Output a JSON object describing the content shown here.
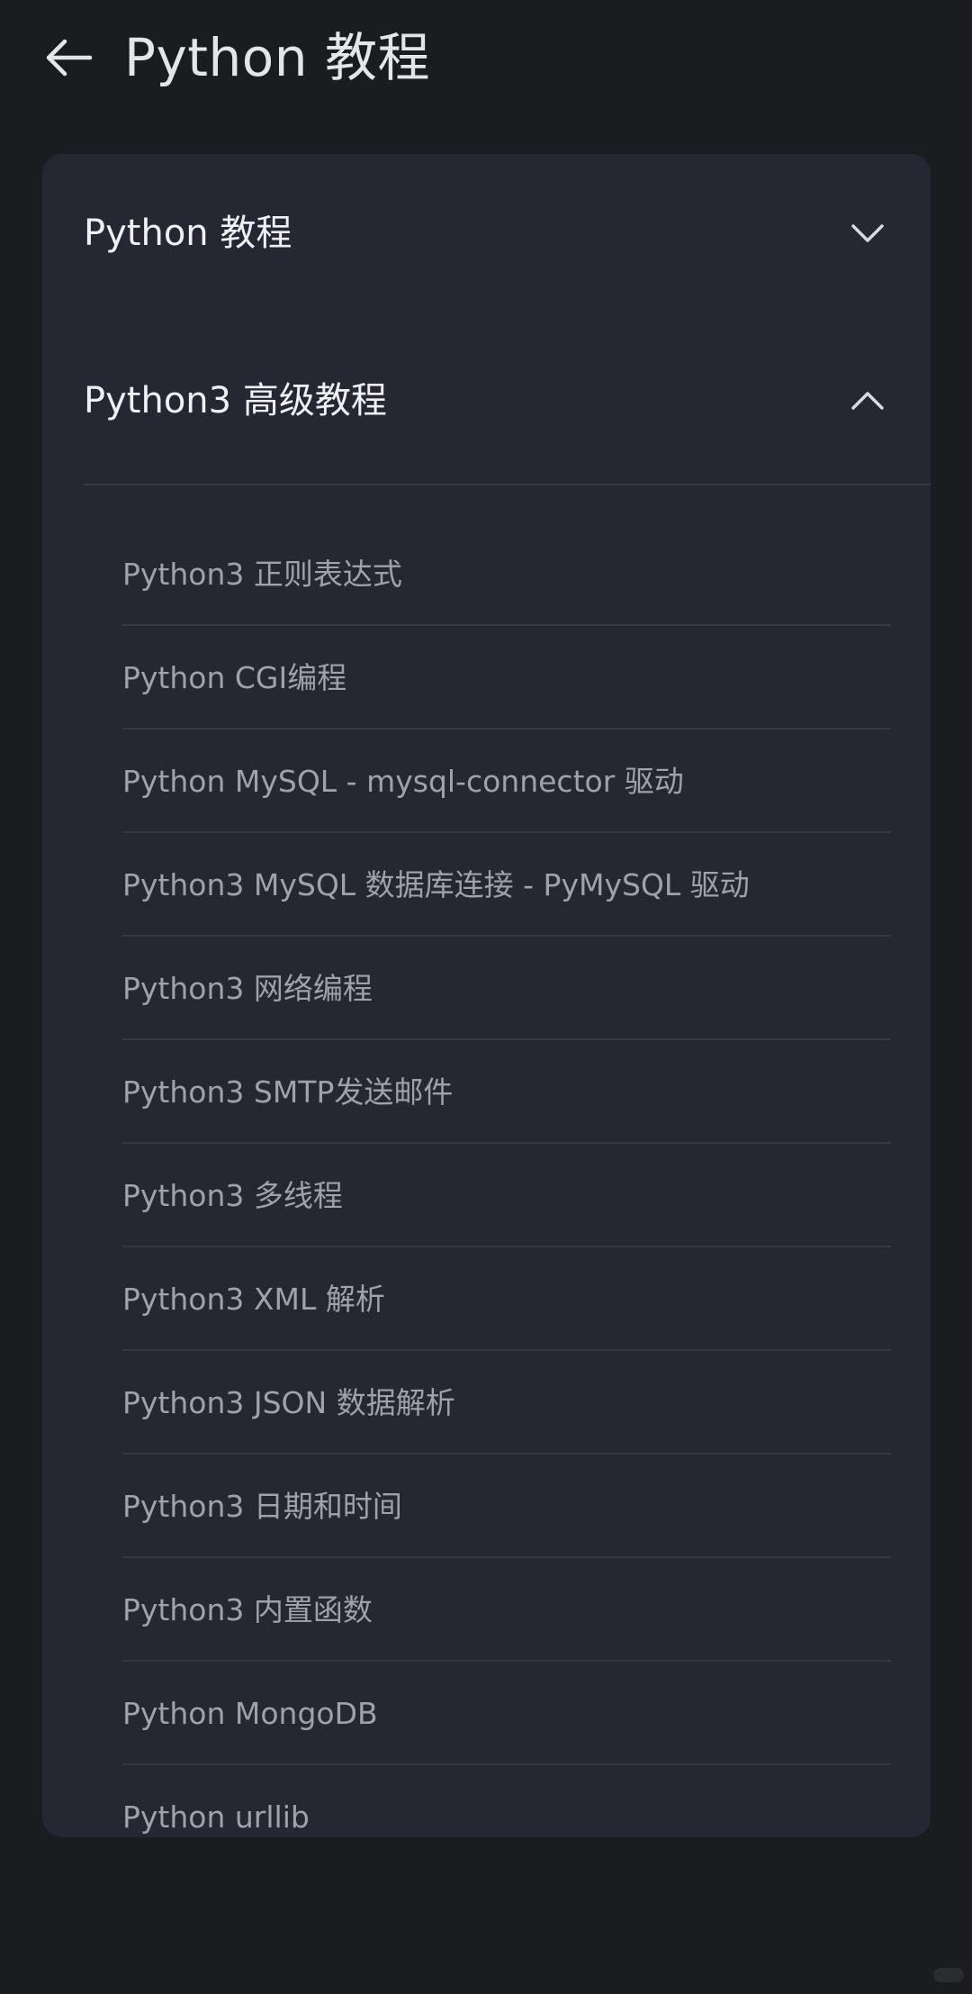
{
  "header": {
    "back_icon": "arrow-left-icon",
    "title": "Python 教程"
  },
  "sections": [
    {
      "label": "Python 教程",
      "expanded": false,
      "icon": "chevron-down-icon"
    },
    {
      "label": "Python3 高级教程",
      "expanded": true,
      "icon": "chevron-up-icon",
      "items": [
        "Python3 正则表达式",
        "Python CGI编程",
        "Python MySQL - mysql-connector 驱动",
        "Python3 MySQL 数据库连接 - PyMySQL 驱动",
        "Python3 网络编程",
        "Python3 SMTP发送邮件",
        "Python3 多线程",
        "Python3 XML 解析",
        "Python3 JSON 数据解析",
        "Python3 日期和时间",
        "Python3 内置函数",
        "Python MongoDB",
        "Python urllib"
      ]
    }
  ],
  "colors": {
    "background": "#1b1c20",
    "card": "#252733",
    "primary_text": "#eef0f3",
    "secondary_text": "#9fa2aa",
    "divider": "#343744"
  }
}
